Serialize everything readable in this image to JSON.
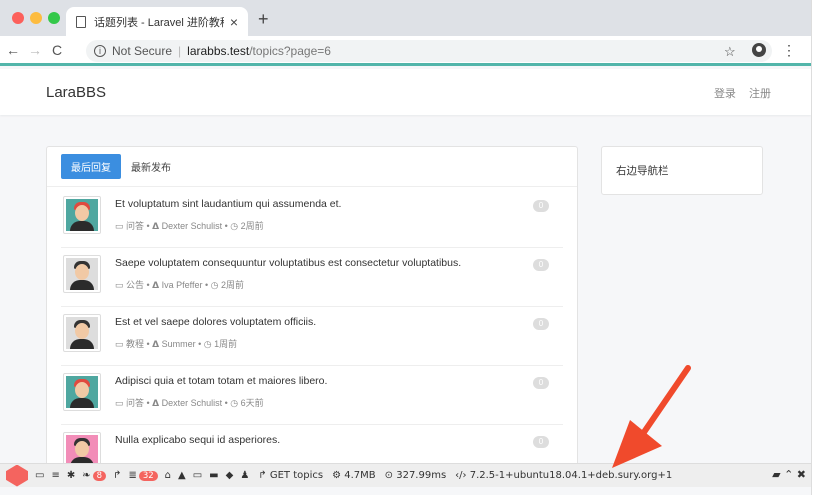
{
  "browser": {
    "tab_title": "话题列表 - Laravel 进阶教程",
    "tab_close": "×",
    "new_tab": "+",
    "nav_back": "←",
    "nav_forward": "→",
    "nav_reload": "C",
    "security_text": "Not Secure",
    "url_host": "larabbs.test",
    "url_path": "/topics?page=6",
    "star": "☆",
    "menu": "⋮"
  },
  "app": {
    "brand": "LaraBBS",
    "login": "登录",
    "register": "注册"
  },
  "main": {
    "tabs": [
      {
        "label": "最后回复"
      },
      {
        "label": "最新发布"
      }
    ],
    "topics": [
      {
        "title": "Et voluptatum sint laudantium qui assumenda et.",
        "meta": "▭ 问答 • 𝝙 Dexter Schulist • ◷ 2周前",
        "replies": "0",
        "hair": "#e04a3f",
        "bg": "#4fa7a0"
      },
      {
        "title": "Saepe voluptatem consequuntur voluptatibus est consectetur voluptatibus.",
        "meta": "▭ 公告 • 𝝙 Iva Pfeffer • ◷ 2周前",
        "replies": "0",
        "hair": "#333333",
        "bg": "#dddddd"
      },
      {
        "title": "Est et vel saepe dolores voluptatem officiis.",
        "meta": "▭ 教程 • 𝝙 Summer • ◷ 1周前",
        "replies": "0",
        "hair": "#333333",
        "bg": "#dddddd"
      },
      {
        "title": "Adipisci quia et totam totam et maiores libero.",
        "meta": "▭ 问答 • 𝝙 Dexter Schulist • ◷ 6天前",
        "replies": "0",
        "hair": "#e04a3f",
        "bg": "#4fa7a0"
      },
      {
        "title": "Nulla explicabo sequi id asperiores.",
        "meta": "",
        "replies": "0",
        "hair": "#333333",
        "bg": "#f28db8"
      }
    ]
  },
  "sidebar": {
    "title": "右边导航栏"
  },
  "debugbar": {
    "messages_count": "8",
    "queries_count": "32",
    "route": "GET topics",
    "memory": "4.7MB",
    "time": "327.99ms",
    "php_version": "7.2.5-1+ubuntu18.04.1+deb.sury.org+1"
  },
  "colors": {
    "accent": "#3b8ee0",
    "toolbar_line": "#52b5aa",
    "debug_red": "#f4645f"
  }
}
